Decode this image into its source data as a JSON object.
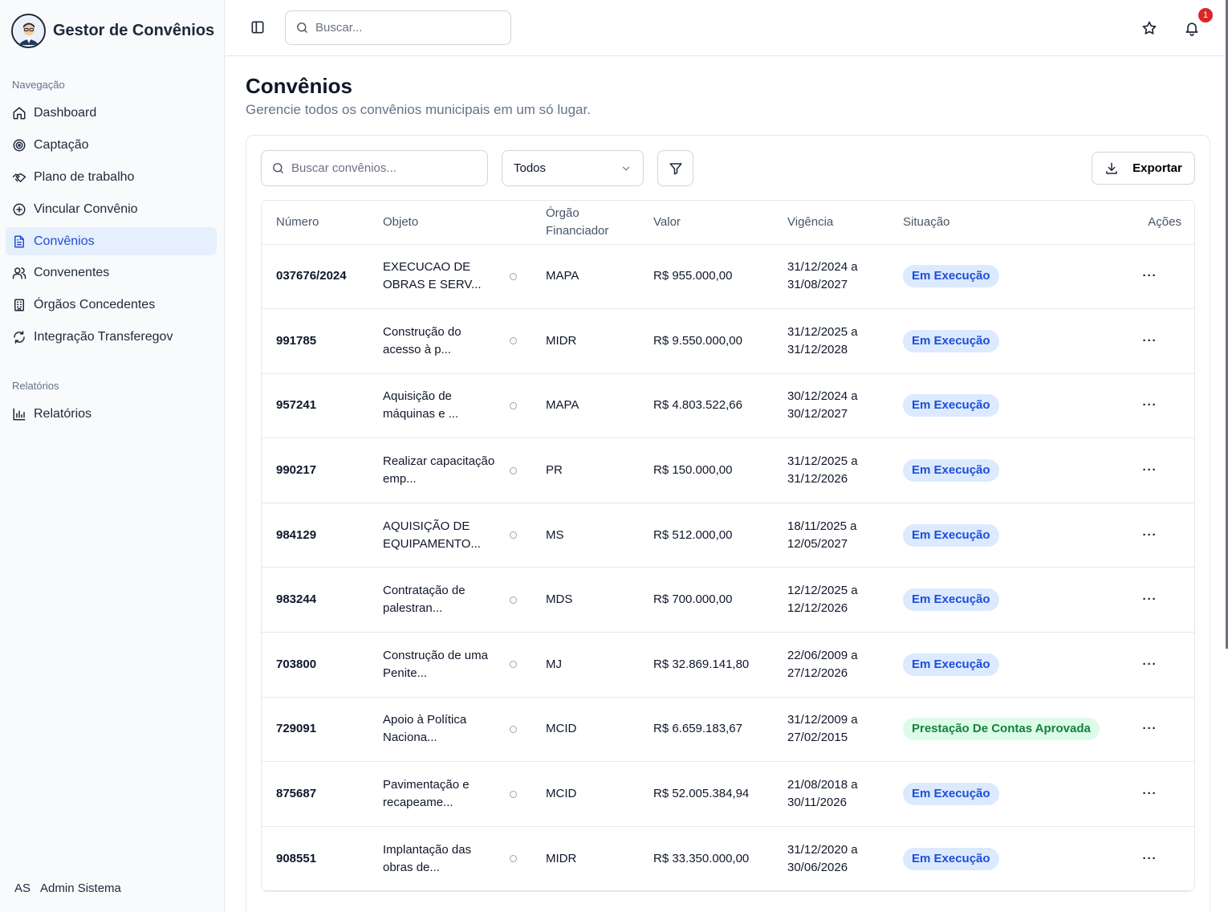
{
  "app": {
    "title": "Gestor de Convênios"
  },
  "sidebar": {
    "sections": [
      {
        "label": "Navegação"
      },
      {
        "label": "Relatórios"
      }
    ],
    "items": [
      {
        "label": "Dashboard",
        "icon": "home-icon"
      },
      {
        "label": "Captação",
        "icon": "target-icon"
      },
      {
        "label": "Plano de trabalho",
        "icon": "handshake-icon"
      },
      {
        "label": "Vincular Convênio",
        "icon": "plus-circle-icon"
      },
      {
        "label": "Convênios",
        "icon": "file-text-icon",
        "active": true
      },
      {
        "label": "Convenentes",
        "icon": "users-icon"
      },
      {
        "label": "Órgãos Concedentes",
        "icon": "building-icon"
      },
      {
        "label": "Integração Transferegov",
        "icon": "refresh-icon"
      },
      {
        "label": "Relatórios",
        "icon": "bar-chart-icon"
      }
    ],
    "user": {
      "initials": "AS",
      "name": "Admin Sistema"
    }
  },
  "topbar": {
    "search_placeholder": "Buscar...",
    "notification_count": "1"
  },
  "page": {
    "title": "Convênios",
    "subtitle": "Gerencie todos os convênios municipais em um só lugar."
  },
  "toolbar": {
    "search_placeholder": "Buscar convênios...",
    "status_value": "Todos",
    "export_label": "Exportar"
  },
  "table": {
    "headers": {
      "numero": "Número",
      "objeto": "Objeto",
      "orgao_line1": "Órgão",
      "orgao_line2": "Financiador",
      "valor": "Valor",
      "vigencia": "Vigência",
      "situacao": "Situação",
      "acoes": "Ações"
    },
    "rows": [
      {
        "numero": "037676/2024",
        "objeto": "EXECUCAO DE OBRAS E SERV...",
        "orgao": "MAPA",
        "valor": "R$ 955.000,00",
        "vig_inicio": "31/12/2024 a",
        "vig_fim": "31/08/2027",
        "situacao": "Em Execução",
        "tipo": "blue"
      },
      {
        "numero": "991785",
        "objeto": "Construção do acesso à p...",
        "orgao": "MIDR",
        "valor": "R$ 9.550.000,00",
        "vig_inicio": "31/12/2025 a",
        "vig_fim": "31/12/2028",
        "situacao": "Em Execução",
        "tipo": "blue"
      },
      {
        "numero": "957241",
        "objeto": "Aquisição de máquinas e ...",
        "orgao": "MAPA",
        "valor": "R$ 4.803.522,66",
        "vig_inicio": "30/12/2024 a",
        "vig_fim": "30/12/2027",
        "situacao": "Em Execução",
        "tipo": "blue"
      },
      {
        "numero": "990217",
        "objeto": "Realizar capacitação emp...",
        "orgao": "PR",
        "valor": "R$ 150.000,00",
        "vig_inicio": "31/12/2025 a",
        "vig_fim": "31/12/2026",
        "situacao": "Em Execução",
        "tipo": "blue"
      },
      {
        "numero": "984129",
        "objeto": "AQUISIÇÃO DE EQUIPAMENTO...",
        "orgao": "MS",
        "valor": "R$ 512.000,00",
        "vig_inicio": "18/11/2025 a",
        "vig_fim": "12/05/2027",
        "situacao": "Em Execução",
        "tipo": "blue"
      },
      {
        "numero": "983244",
        "objeto": "Contratação de palestran...",
        "orgao": "MDS",
        "valor": "R$ 700.000,00",
        "vig_inicio": "12/12/2025 a",
        "vig_fim": "12/12/2026",
        "situacao": "Em Execução",
        "tipo": "blue"
      },
      {
        "numero": "703800",
        "objeto": "Construção de uma Penite...",
        "orgao": "MJ",
        "valor": "R$ 32.869.141,80",
        "vig_inicio": "22/06/2009 a",
        "vig_fim": "27/12/2026",
        "situacao": "Em Execução",
        "tipo": "blue"
      },
      {
        "numero": "729091",
        "objeto": "Apoio à Política Naciona...",
        "orgao": "MCID",
        "valor": "R$ 6.659.183,67",
        "vig_inicio": "31/12/2009 a",
        "vig_fim": "27/02/2015",
        "situacao": "Prestação De Contas Aprovada",
        "tipo": "green"
      },
      {
        "numero": "875687",
        "objeto": "Pavimentação e recapeame...",
        "orgao": "MCID",
        "valor": "R$ 52.005.384,94",
        "vig_inicio": "21/08/2018 a",
        "vig_fim": "30/11/2026",
        "situacao": "Em Execução",
        "tipo": "blue"
      },
      {
        "numero": "908551",
        "objeto": "Implantação das obras de...",
        "orgao": "MIDR",
        "valor": "R$ 33.350.000,00",
        "vig_inicio": "31/12/2020 a",
        "vig_fim": "30/06/2026",
        "situacao": "Em Execução",
        "tipo": "blue"
      }
    ],
    "actions_glyph": "···"
  }
}
